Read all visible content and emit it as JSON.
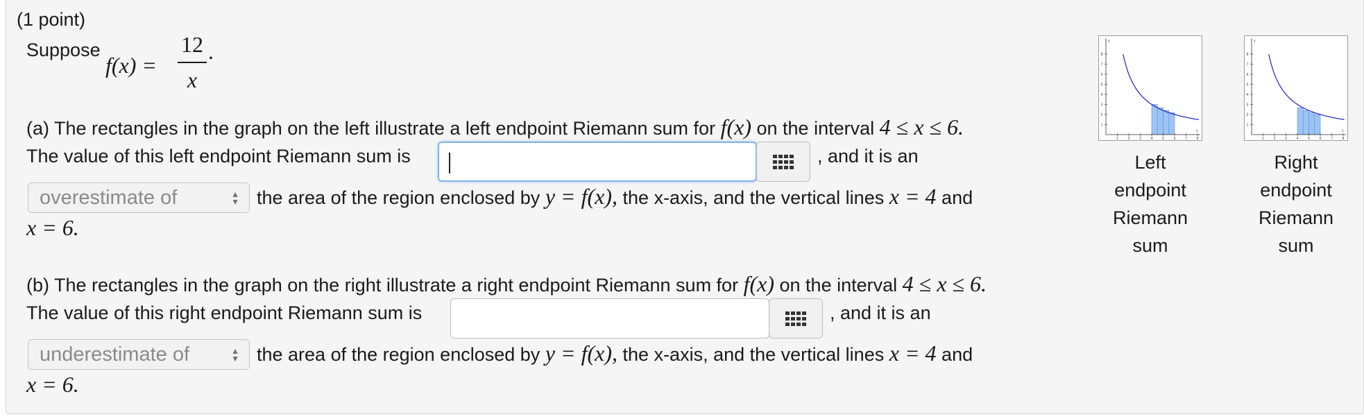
{
  "header": {
    "points": "(1 point)"
  },
  "intro": {
    "suppose": "Suppose",
    "f_lhs": "f(x) =",
    "numerator": "12",
    "denominator": "x",
    "period": "."
  },
  "part_a": {
    "line1": "(a) The rectangles in the graph on the left illustrate a left endpoint Riemann sum for",
    "fx": "f(x)",
    "on_interval": "on the interval",
    "interval": "4 ≤ x ≤ 6.",
    "value_text": "The value of this left endpoint Riemann sum is",
    "answer_value": "",
    "and_it_is_an": ", and it is an",
    "select_value": "overestimate of",
    "area_text": "the area of the region enclosed by",
    "y_eq": "y = f(x),",
    "xaxis_text": "the x-axis, and the vertical lines",
    "x4": "x = 4",
    "and": "and",
    "x6": "x = 6."
  },
  "part_b": {
    "line1": "(b) The rectangles in the graph on the right illustrate a right endpoint Riemann sum for",
    "fx": "f(x)",
    "on_interval": "on the interval",
    "interval": "4 ≤ x ≤ 6.",
    "value_text": "The value of this right endpoint Riemann sum is",
    "answer_value": "",
    "and_it_is_an": ", and it is an",
    "select_value": "underestimate of",
    "area_text": "the area of the region enclosed by",
    "y_eq": "y = f(x),",
    "xaxis_text": "the x-axis, and the vertical lines",
    "x4": "x = 4",
    "and": "and",
    "x6": "x = 6."
  },
  "graphs": {
    "left_caption": [
      "Left",
      "endpoint",
      "Riemann",
      "sum"
    ],
    "right_caption": [
      "Right",
      "endpoint",
      "Riemann",
      "sum"
    ],
    "x_ticks": [
      "1",
      "2",
      "3",
      "4",
      "5",
      "6",
      "7",
      "8"
    ],
    "y_ticks": [
      "1",
      "2",
      "3",
      "4",
      "5",
      "6",
      "7",
      "8"
    ],
    "x_label": "x",
    "y_label": "y",
    "curve_color": "#1f1fd6",
    "rect_color": "#9cc4f4"
  },
  "icons": {
    "palette": "keypad-grid-icon",
    "select_arrows": "up-down-arrows-icon"
  }
}
